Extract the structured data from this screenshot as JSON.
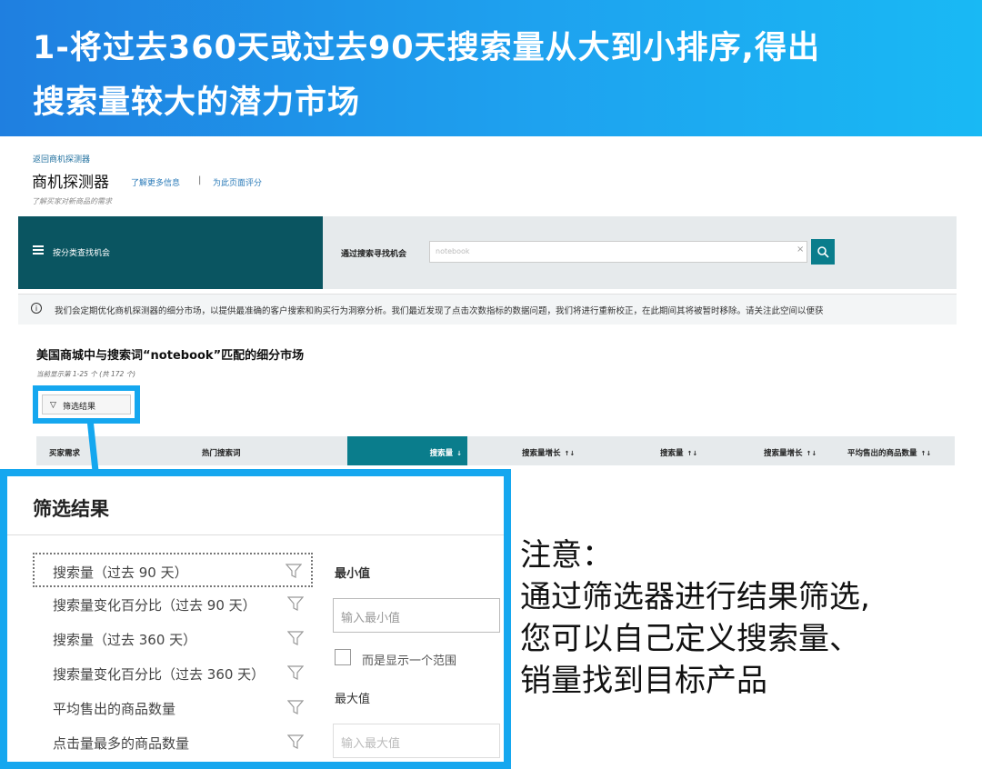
{
  "banner": {
    "line1": "1-将过去360天或过去90天搜索量从大到小排序,得出",
    "line2": "搜索量较大的潜力市场"
  },
  "page": {
    "back_link": "返回商机探测器",
    "title": "商机探测器",
    "learn_more": "了解更多信息",
    "separator": "|",
    "rate_page": "为此页面评分",
    "subtitle": "了解买家对新商品的需求"
  },
  "navbar": {
    "browse_label": "按分类查找机会",
    "search_label": "通过搜索寻找机会",
    "search_value": "notebook",
    "clear": "×"
  },
  "notice": {
    "icon": "i",
    "text": "我们会定期优化商机探测器的细分市场，以提供最准确的客户搜索和购买行为洞察分析。我们最近发现了点击次数指标的数据问题，我们将进行重新校正，在此期间其将被暂时移除。请关注此空间以便获"
  },
  "results": {
    "title": "美国商城中与搜索词“notebook”匹配的细分市场",
    "count": "当前显示第 1-25 个 (共 172 个)",
    "filter_button": "筛选结果"
  },
  "table": {
    "headers": [
      "买家需求",
      "热门搜索词",
      "搜索量",
      "搜索量增长",
      "搜索量",
      "搜索量增长",
      "平均售出的商品数量"
    ],
    "sort_arrows": [
      "",
      "",
      "↓",
      "↑↓",
      "↑↓",
      "↑↓",
      "↑↓"
    ]
  },
  "panel": {
    "title": "筛选结果",
    "filters": [
      "搜索量（过去 90 天）",
      "搜索量变化百分比（过去 90 天）",
      "搜索量（过去 360 天）",
      "搜索量变化百分比（过去 360 天）",
      "平均售出的商品数量",
      "点击量最多的商品数量"
    ],
    "min_label": "最小值",
    "min_placeholder": "输入最小值",
    "checkbox_label": "而是显示一个范围",
    "max_label": "最大值",
    "max_placeholder": "输入最大值"
  },
  "note": {
    "line1": "注意：",
    "line2": "通过筛选器进行结果筛选,",
    "line3": "您可以自己定义搜索量、",
    "line4": "销量找到目标产品"
  },
  "colors": {
    "banner_start": "#1f7fe0",
    "banner_end": "#19b9f4",
    "highlight": "#15a7ef",
    "teal": "#0a7d8c",
    "nav_dark": "#0a5561"
  }
}
